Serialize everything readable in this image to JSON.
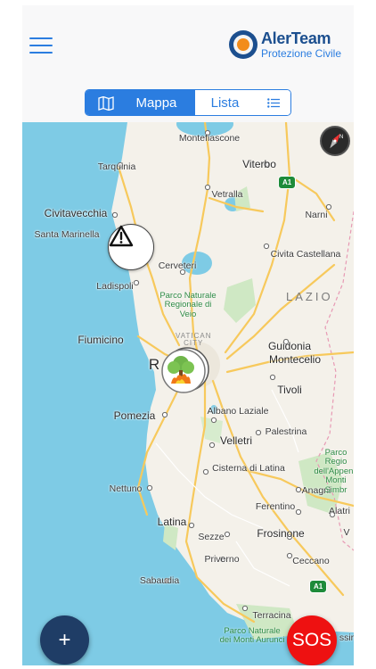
{
  "header": {
    "menu_icon": "hamburger-menu-icon",
    "brand_title": "AlerTeam",
    "brand_subtitle": "Protezione Civile"
  },
  "view_toggle": {
    "options": [
      {
        "label": "Mappa",
        "icon": "map-icon",
        "selected": true
      },
      {
        "label": "Lista",
        "icon": "list-icon",
        "selected": false
      }
    ]
  },
  "map": {
    "cities": [
      {
        "id": "montefiascone",
        "label": "Montefiascone"
      },
      {
        "id": "tarquinia",
        "label": "Tarquinia"
      },
      {
        "id": "viterbo",
        "label": "Viterbo"
      },
      {
        "id": "vetralla",
        "label": "Vetralla"
      },
      {
        "id": "civitavecchia",
        "label": "Civitavecchia"
      },
      {
        "id": "narni",
        "label": "Narni"
      },
      {
        "id": "santa_marinella",
        "label": "Santa Marinella"
      },
      {
        "id": "cerveteri",
        "label": "Cerveteri"
      },
      {
        "id": "civita_castellana",
        "label": "Civita Castellana"
      },
      {
        "id": "ladispoli",
        "label": "Ladispoli"
      },
      {
        "id": "fiumicino",
        "label": "Fiumicino"
      },
      {
        "id": "guidonia",
        "label": "Guidonia"
      },
      {
        "id": "montecelio",
        "label": "Montecelio"
      },
      {
        "id": "roma",
        "label": "R"
      },
      {
        "id": "tivoli",
        "label": "Tivoli"
      },
      {
        "id": "albano",
        "label": "Albano Laziale"
      },
      {
        "id": "pomezia",
        "label": "Pomezia"
      },
      {
        "id": "palestrina",
        "label": "Palestrina"
      },
      {
        "id": "velletri",
        "label": "Velletri"
      },
      {
        "id": "cisterna",
        "label": "Cisterna di Latina"
      },
      {
        "id": "nettuno",
        "label": "Nettuno"
      },
      {
        "id": "anagni",
        "label": "Anagni"
      },
      {
        "id": "ferentino",
        "label": "Ferentino"
      },
      {
        "id": "alatri",
        "label": "Alatri"
      },
      {
        "id": "latina",
        "label": "Latina"
      },
      {
        "id": "sezze",
        "label": "Sezze"
      },
      {
        "id": "frosinone",
        "label": "Frosinone"
      },
      {
        "id": "veroli",
        "label": "V"
      },
      {
        "id": "priverno",
        "label": "Priverno"
      },
      {
        "id": "ceccano",
        "label": "Ceccano"
      },
      {
        "id": "sabaudia",
        "label": "Sabaudia"
      },
      {
        "id": "terracina",
        "label": "Terracina"
      },
      {
        "id": "cassino",
        "label": "ssir"
      }
    ],
    "region_label": "LAZIO",
    "vatican_label_1": "VATICAN",
    "vatican_label_2": "CITY",
    "parks": [
      {
        "id": "veio",
        "line1": "Parco Naturale",
        "line2": "Regionale di",
        "line3": "Veio"
      },
      {
        "id": "simbruini",
        "line1": "Parco Regio",
        "line2": "dell'Appenn",
        "line3": "Monti Simbr"
      },
      {
        "id": "aurunci",
        "line1": "Parco Naturale",
        "line2": "dei Monti Aurunci",
        "line3": ""
      }
    ],
    "highway_shields": [
      "A1",
      "A1"
    ],
    "compass_icon": "compass-icon",
    "alert_marker_icon": "warning-triangle-icon",
    "fire_marker_icon": "wildfire-icon"
  },
  "actions": {
    "add_label": "+",
    "sos_label": "SOS"
  },
  "colors": {
    "accent": "#2b7de0",
    "brand": "#1c4f8f",
    "sos": "#ee1111",
    "fab": "#1f3d66",
    "sea": "#7ecbe5"
  }
}
